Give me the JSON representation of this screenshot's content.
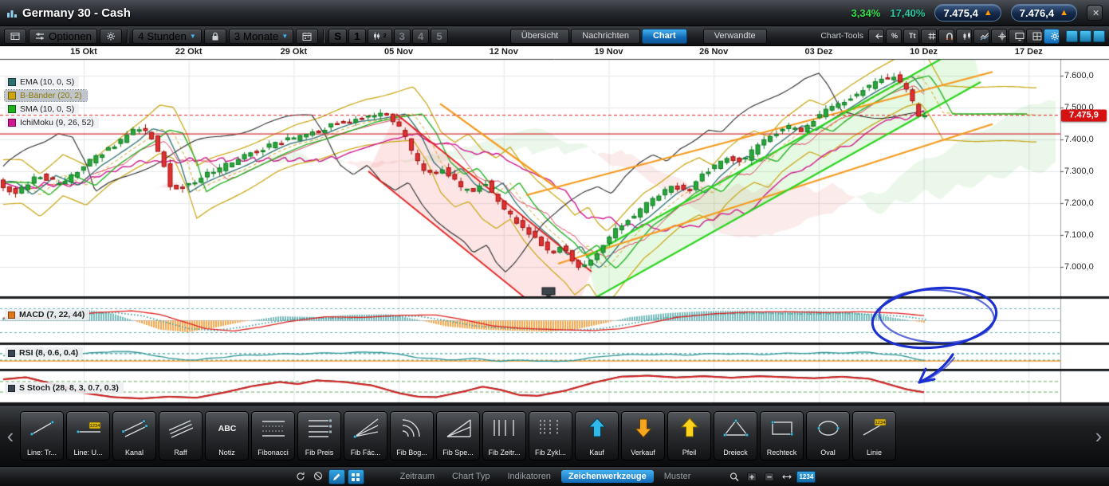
{
  "titlebar": {
    "title": "Germany 30 - Cash",
    "change_pct_day": "3,34%",
    "change_pct_period": "17,40%",
    "sell_price": "7.475,4",
    "buy_price": "7.476,4",
    "tick_up_glyph": "▲",
    "close_glyph": "✕"
  },
  "toolbar": {
    "options_label": "Optionen",
    "interval_value": "4 Stunden",
    "range_value": "3 Monate",
    "caret_glyph": "▼",
    "layout_buttons": [
      "S",
      "1",
      "2",
      "3",
      "4",
      "5"
    ],
    "tabs": [
      {
        "label": "Übersicht",
        "active": false
      },
      {
        "label": "Nachrichten",
        "active": false
      },
      {
        "label": "Chart",
        "active": true
      },
      {
        "label": "Verwandte",
        "active": false
      }
    ],
    "chart_tools_label": "Chart-Tools",
    "chart_tools_icons": [
      {
        "name": "undo-icon",
        "active": false
      },
      {
        "name": "percent-icon",
        "glyph": "%",
        "active": false
      },
      {
        "name": "text-size-icon",
        "glyph": "Tt",
        "active": false
      },
      {
        "name": "grid-icon",
        "active": false
      },
      {
        "name": "magnet-icon",
        "active": false
      },
      {
        "name": "chart-type-icon",
        "active": false
      },
      {
        "name": "compare-icon",
        "active": false
      },
      {
        "name": "crosshair-icon",
        "active": false
      },
      {
        "name": "screen-icon",
        "active": false
      },
      {
        "name": "layout-icon",
        "active": false
      },
      {
        "name": "settings-icon",
        "active": true
      }
    ]
  },
  "chart_data": {
    "type": "candlestick",
    "instrument": "Germany 30 - Cash",
    "interval": "4 Stunden",
    "range": "3 Monate",
    "x_labels": [
      "15 Okt",
      "22 Okt",
      "29 Okt",
      "05 Nov",
      "12 Nov",
      "19 Nov",
      "26 Nov",
      "03 Dez",
      "10 Dez",
      "17 Dez"
    ],
    "y_ticks": [
      "7.600,0",
      "7.500,0",
      "7.400,0",
      "7.300,0",
      "7.200,0",
      "7.100,0",
      "7.000,0"
    ],
    "y_axis_prices": [
      7600,
      7500,
      7400,
      7300,
      7200,
      7100,
      7000
    ],
    "current_price_label": "7.475,9",
    "current_price": 7475.9,
    "horizontal_line_price": 7417,
    "legend": [
      {
        "label": "EMA (10, 0, S)",
        "color": "#2e6f6f",
        "selected": false
      },
      {
        "label": "B-Bänder (20, 2)",
        "color": "#c9a50e",
        "selected": true
      },
      {
        "label": "SMA (10, 0, S)",
        "color": "#22b022",
        "selected": false
      },
      {
        "label": "IchiMoku (9, 26, 52)",
        "color": "#d01890",
        "selected": false
      }
    ],
    "price_path": [
      [
        0,
        7265
      ],
      [
        0.02,
        7225
      ],
      [
        0.045,
        7290
      ],
      [
        0.07,
        7255
      ],
      [
        0.095,
        7320
      ],
      [
        0.115,
        7360
      ],
      [
        0.135,
        7395
      ],
      [
        0.15,
        7430
      ],
      [
        0.165,
        7420
      ],
      [
        0.18,
        7330
      ],
      [
        0.19,
        7235
      ],
      [
        0.205,
        7260
      ],
      [
        0.225,
        7285
      ],
      [
        0.25,
        7320
      ],
      [
        0.275,
        7355
      ],
      [
        0.3,
        7385
      ],
      [
        0.325,
        7405
      ],
      [
        0.35,
        7430
      ],
      [
        0.375,
        7455
      ],
      [
        0.4,
        7470
      ],
      [
        0.425,
        7480
      ],
      [
        0.44,
        7420
      ],
      [
        0.455,
        7330
      ],
      [
        0.47,
        7290
      ],
      [
        0.485,
        7310
      ],
      [
        0.5,
        7255
      ],
      [
        0.515,
        7230
      ],
      [
        0.53,
        7265
      ],
      [
        0.545,
        7200
      ],
      [
        0.56,
        7150
      ],
      [
        0.575,
        7110
      ],
      [
        0.59,
        7075
      ],
      [
        0.6,
        7040
      ],
      [
        0.615,
        7070
      ],
      [
        0.625,
        7020
      ],
      [
        0.635,
        6995
      ],
      [
        0.645,
        7025
      ],
      [
        0.66,
        7080
      ],
      [
        0.675,
        7130
      ],
      [
        0.69,
        7160
      ],
      [
        0.705,
        7195
      ],
      [
        0.72,
        7230
      ],
      [
        0.735,
        7255
      ],
      [
        0.75,
        7235
      ],
      [
        0.765,
        7285
      ],
      [
        0.78,
        7320
      ],
      [
        0.795,
        7345
      ],
      [
        0.81,
        7330
      ],
      [
        0.825,
        7380
      ],
      [
        0.84,
        7410
      ],
      [
        0.855,
        7440
      ],
      [
        0.87,
        7425
      ],
      [
        0.885,
        7460
      ],
      [
        0.9,
        7490
      ],
      [
        0.915,
        7515
      ],
      [
        0.93,
        7540
      ],
      [
        0.945,
        7565
      ],
      [
        0.96,
        7590
      ],
      [
        0.975,
        7600
      ],
      [
        0.985,
        7560
      ],
      [
        1,
        7480
      ]
    ],
    "bollinger_width": [
      [
        0,
        70
      ],
      [
        0.12,
        60
      ],
      [
        0.2,
        85
      ],
      [
        0.3,
        60
      ],
      [
        0.42,
        75
      ],
      [
        0.5,
        105
      ],
      [
        0.62,
        125
      ],
      [
        0.72,
        95
      ],
      [
        0.82,
        80
      ],
      [
        1,
        85
      ]
    ],
    "channels": {
      "red_a": [
        [
          497,
          7480
        ],
        [
          742,
          6985
        ]
      ],
      "red_b": [
        [
          462,
          7300
        ],
        [
          712,
          6795
        ]
      ],
      "green_a": [
        [
          735,
          7030
        ],
        [
          1218,
          7705
        ]
      ],
      "green_b": [
        [
          748,
          6905
        ],
        [
          1230,
          7580
        ]
      ],
      "orange_down": [
        [
          552,
          7512
        ],
        [
          700,
          7245
        ]
      ],
      "orange_up_1": [
        [
          660,
          7225
        ],
        [
          1245,
          7612
        ]
      ],
      "orange_up_2": [
        [
          700,
          7010
        ],
        [
          1245,
          7448
        ]
      ]
    },
    "indicators": {
      "macd": {
        "label": "MACD (7, 22, 44)",
        "chip_color": "#e07818",
        "values": [
          [
            0,
            0.15
          ],
          [
            0.05,
            0.45
          ],
          [
            0.09,
            0.55
          ],
          [
            0.12,
            0.35
          ],
          [
            0.145,
            -0.05
          ],
          [
            0.17,
            -0.45
          ],
          [
            0.2,
            -0.58
          ],
          [
            0.23,
            -0.35
          ],
          [
            0.26,
            -0.05
          ],
          [
            0.3,
            0.22
          ],
          [
            0.34,
            0.18
          ],
          [
            0.38,
            0.3
          ],
          [
            0.42,
            0.32
          ],
          [
            0.45,
            0.05
          ],
          [
            0.48,
            -0.28
          ],
          [
            0.51,
            -0.42
          ],
          [
            0.55,
            -0.5
          ],
          [
            0.59,
            -0.55
          ],
          [
            0.62,
            -0.45
          ],
          [
            0.65,
            -0.15
          ],
          [
            0.68,
            0.18
          ],
          [
            0.72,
            0.38
          ],
          [
            0.76,
            0.48
          ],
          [
            0.8,
            0.5
          ],
          [
            0.84,
            0.45
          ],
          [
            0.88,
            0.5
          ],
          [
            0.92,
            0.42
          ],
          [
            0.95,
            0.28
          ],
          [
            0.97,
            0.12
          ],
          [
            1,
            -0.1
          ]
        ]
      },
      "rsi": {
        "label": "RSI (8, 0.6, 0.4)",
        "chip_color": "#3a4550",
        "values": [
          [
            0,
            0.55
          ],
          [
            0.04,
            0.72
          ],
          [
            0.08,
            0.62
          ],
          [
            0.12,
            0.78
          ],
          [
            0.15,
            0.7
          ],
          [
            0.18,
            0.42
          ],
          [
            0.21,
            0.35
          ],
          [
            0.25,
            0.55
          ],
          [
            0.29,
            0.62
          ],
          [
            0.33,
            0.66
          ],
          [
            0.37,
            0.7
          ],
          [
            0.41,
            0.74
          ],
          [
            0.45,
            0.48
          ],
          [
            0.48,
            0.36
          ],
          [
            0.51,
            0.42
          ],
          [
            0.54,
            0.3
          ],
          [
            0.57,
            0.34
          ],
          [
            0.6,
            0.26
          ],
          [
            0.63,
            0.4
          ],
          [
            0.66,
            0.58
          ],
          [
            0.7,
            0.62
          ],
          [
            0.74,
            0.6
          ],
          [
            0.78,
            0.66
          ],
          [
            0.82,
            0.62
          ],
          [
            0.86,
            0.68
          ],
          [
            0.9,
            0.7
          ],
          [
            0.94,
            0.72
          ],
          [
            0.97,
            0.58
          ],
          [
            1,
            0.34
          ]
        ]
      },
      "stoch": {
        "label": "S Stoch (28, 8, 3, 0.7, 0.3)",
        "chip_color": "#3a4550",
        "values": [
          [
            0,
            0.78
          ],
          [
            0.025,
            0.86
          ],
          [
            0.06,
            0.55
          ],
          [
            0.09,
            0.25
          ],
          [
            0.12,
            0.1
          ],
          [
            0.15,
            0.05
          ],
          [
            0.18,
            0.12
          ],
          [
            0.21,
            0.08
          ],
          [
            0.24,
            0.28
          ],
          [
            0.27,
            0.52
          ],
          [
            0.3,
            0.68
          ],
          [
            0.32,
            0.6
          ],
          [
            0.34,
            0.74
          ],
          [
            0.37,
            0.68
          ],
          [
            0.4,
            0.55
          ],
          [
            0.43,
            0.25
          ],
          [
            0.45,
            0.12
          ],
          [
            0.47,
            0.1
          ],
          [
            0.5,
            0.32
          ],
          [
            0.52,
            0.5
          ],
          [
            0.54,
            0.38
          ],
          [
            0.56,
            0.18
          ],
          [
            0.58,
            0.15
          ],
          [
            0.61,
            0.35
          ],
          [
            0.64,
            0.65
          ],
          [
            0.67,
            0.88
          ],
          [
            0.7,
            0.92
          ],
          [
            0.73,
            0.85
          ],
          [
            0.76,
            0.9
          ],
          [
            0.79,
            0.84
          ],
          [
            0.82,
            0.9
          ],
          [
            0.85,
            0.86
          ],
          [
            0.88,
            0.82
          ],
          [
            0.91,
            0.88
          ],
          [
            0.94,
            0.8
          ],
          [
            0.96,
            0.6
          ],
          [
            0.98,
            0.4
          ],
          [
            1,
            0.28
          ]
        ]
      }
    }
  },
  "tools": {
    "scroll_left_glyph": "‹",
    "scroll_right_glyph": "›",
    "items": [
      {
        "label": "Line: Tr...",
        "icon": "trend-line-icon"
      },
      {
        "label": "Line: U...",
        "icon": "level-line-icon"
      },
      {
        "label": "Kanal",
        "icon": "channel-icon"
      },
      {
        "label": "Raff",
        "icon": "raff-channel-icon"
      },
      {
        "label": "Notiz",
        "icon": "note-icon"
      },
      {
        "label": "Fibonacci",
        "icon": "fibonacci-icon"
      },
      {
        "label": "Fib Preis",
        "icon": "fib-price-icon"
      },
      {
        "label": "Fib Fäc...",
        "icon": "fib-fan-icon"
      },
      {
        "label": "Fib Bog...",
        "icon": "fib-arcs-icon"
      },
      {
        "label": "Fib Spe...",
        "icon": "fib-speed-icon"
      },
      {
        "label": "Fib Zeitr...",
        "icon": "fib-time-icon"
      },
      {
        "label": "Fib Zykl...",
        "icon": "fib-cycle-icon"
      },
      {
        "label": "Kauf",
        "icon": "buy-arrow-icon"
      },
      {
        "label": "Verkauf",
        "icon": "sell-arrow-icon"
      },
      {
        "label": "Pfeil",
        "icon": "arrow-icon"
      },
      {
        "label": "Dreieck",
        "icon": "triangle-icon"
      },
      {
        "label": "Rechteck",
        "icon": "rectangle-icon"
      },
      {
        "label": "Oval",
        "icon": "oval-icon"
      },
      {
        "label": "Linie",
        "icon": "line-icon"
      }
    ]
  },
  "statusbar": {
    "left_icons": [
      {
        "name": "rotate-icon",
        "active": false
      },
      {
        "name": "disable-icon",
        "active": false
      },
      {
        "name": "pencil-icon",
        "active": true
      },
      {
        "name": "snap-grid-icon",
        "active": true
      }
    ],
    "items": [
      {
        "label": "Zeitraum",
        "active": false
      },
      {
        "label": "Chart Typ",
        "active": false
      },
      {
        "label": "Indikatoren",
        "active": false
      },
      {
        "label": "Zeichenwerkzeuge",
        "active": true
      },
      {
        "label": "Muster",
        "active": false
      }
    ],
    "right_icons": [
      {
        "name": "zoom-icon"
      },
      {
        "name": "zoom-in-icon"
      },
      {
        "name": "zoom-out-icon"
      },
      {
        "name": "fit-icon"
      },
      {
        "name": "values-badge",
        "glyph": "1234"
      }
    ]
  },
  "annotations": {
    "color": "#1b2fd0"
  }
}
